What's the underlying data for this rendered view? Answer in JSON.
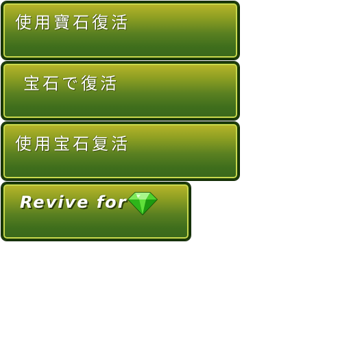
{
  "buttons": {
    "traditional_chinese": {
      "label": "使用寶石復活"
    },
    "japanese": {
      "label": "宝石で復活"
    },
    "simplified_chinese": {
      "label": "使用宝石复活"
    },
    "english": {
      "label": "Revive for",
      "icon": "green-gem-icon"
    }
  },
  "colors": {
    "button_top": "#b9b62a",
    "button_bottom": "#3a681b",
    "border": "#1a3a07",
    "text": "#ffffff",
    "gem": "#35c81f"
  }
}
